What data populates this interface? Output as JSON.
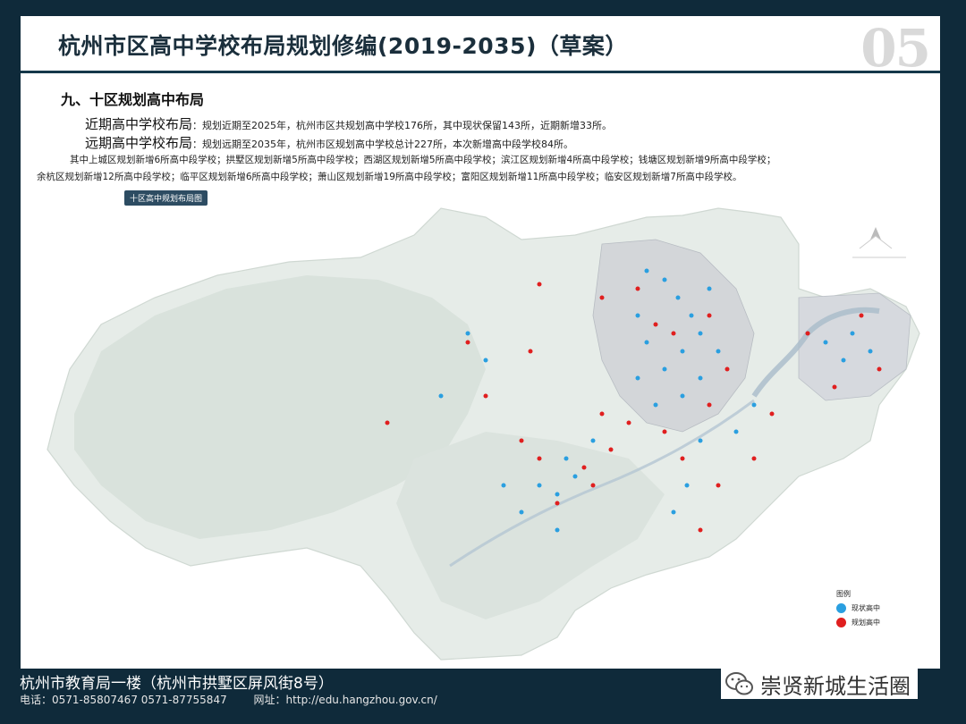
{
  "header": {
    "title": "杭州市区高中学校布局规划修编(2019-2035)（草案）",
    "page_number": "05"
  },
  "section": {
    "heading": "九、十区规划高中布局"
  },
  "near_term": {
    "label": "近期高中学校布局",
    "text": "：规划近期至2025年，杭州市区共规划高中学校176所，其中现状保留143所，近期新增33所。"
  },
  "long_term": {
    "label": "远期高中学校布局",
    "text": "：规划远期至2035年，杭州市区规划高中学校总计227所，本次新增高中段学校84所。"
  },
  "district_details": {
    "line1": "其中上城区规划新增6所高中段学校；拱墅区规划新增5所高中段学校；西湖区规划新增5所高中段学校；滨江区规划新增4所高中段学校；钱塘区规划新增9所高中段学校；",
    "line2": "余杭区规划新增12所高中段学校；临平区规划新增6所高中段学校；萧山区规划新增19所高中段学校；富阳区规划新增11所高中段学校；临安区规划新增7所高中段学校。"
  },
  "map": {
    "tag": "十区高中规划布局图",
    "legend_title": "图例",
    "legend_items": [
      {
        "label": "现状高中",
        "color": "#2a9fe0"
      },
      {
        "label": "规划高中",
        "color": "#e01f1f"
      }
    ]
  },
  "footer": {
    "address": "杭州市教育局一楼（杭州市拱墅区屏风街8号）",
    "phone": "电话：0571-85807467  0571-87755847",
    "website": "网址：http://edu.hangzhou.gov.cn/"
  },
  "watermark": {
    "text": "崇贤新城生活圈",
    "icon": "wechat-icon"
  }
}
